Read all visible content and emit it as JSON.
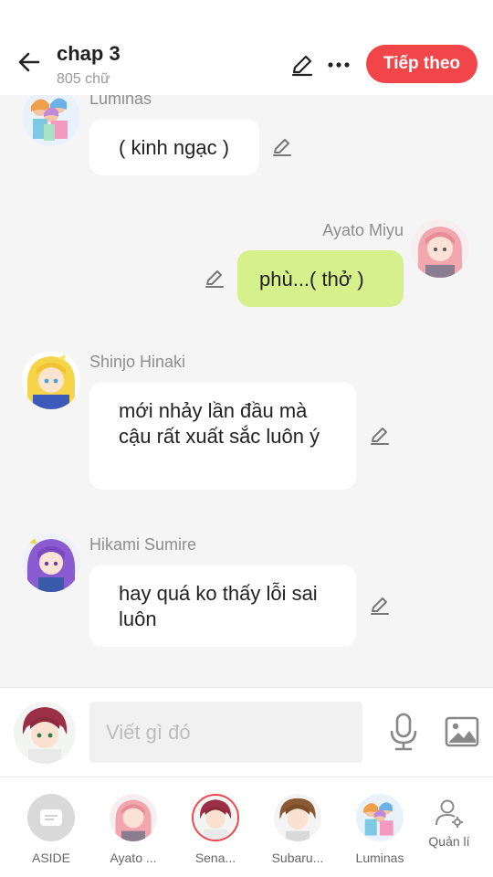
{
  "header": {
    "title": "chap 3",
    "word_count": "805 chữ",
    "next_label": "Tiếp theo",
    "accent_color": "#f2454a"
  },
  "messages": [
    {
      "name": "Luminas",
      "text": "( kinh ngạc )",
      "side": "left",
      "avatar": "luminas-avatar"
    },
    {
      "name": "Ayato  Miyu",
      "text": "phù...( thở )",
      "side": "right",
      "avatar": "ayato-avatar"
    },
    {
      "name": "Shinjo Hinaki",
      "text": "mới nhảy lần đầu mà cậu rất xuất sắc luôn ý",
      "side": "left",
      "avatar": "hinaki-avatar"
    },
    {
      "name": "Hikami Sumire",
      "text": "hay quá ko thấy lỗi sai luôn",
      "side": "left",
      "avatar": "sumire-avatar"
    }
  ],
  "composer": {
    "placeholder": "Viết gì đó",
    "mic_icon": "mic-icon",
    "image_icon": "image-icon"
  },
  "characters": [
    {
      "label": "ASIDE",
      "icon": "aside-icon"
    },
    {
      "label": "Ayato ...",
      "icon": "ayato-avatar"
    },
    {
      "label": "Sena...",
      "icon": "sena-avatar"
    },
    {
      "label": "Subaru...",
      "icon": "subaru-avatar"
    },
    {
      "label": "Luminas",
      "icon": "luminas-avatar"
    },
    {
      "label": "Quản lí",
      "icon": "manage-user-icon"
    }
  ],
  "colors": {
    "my_bubble": "#d6f18b",
    "other_bubble": "#ffffff",
    "background": "#f5f5f5"
  }
}
